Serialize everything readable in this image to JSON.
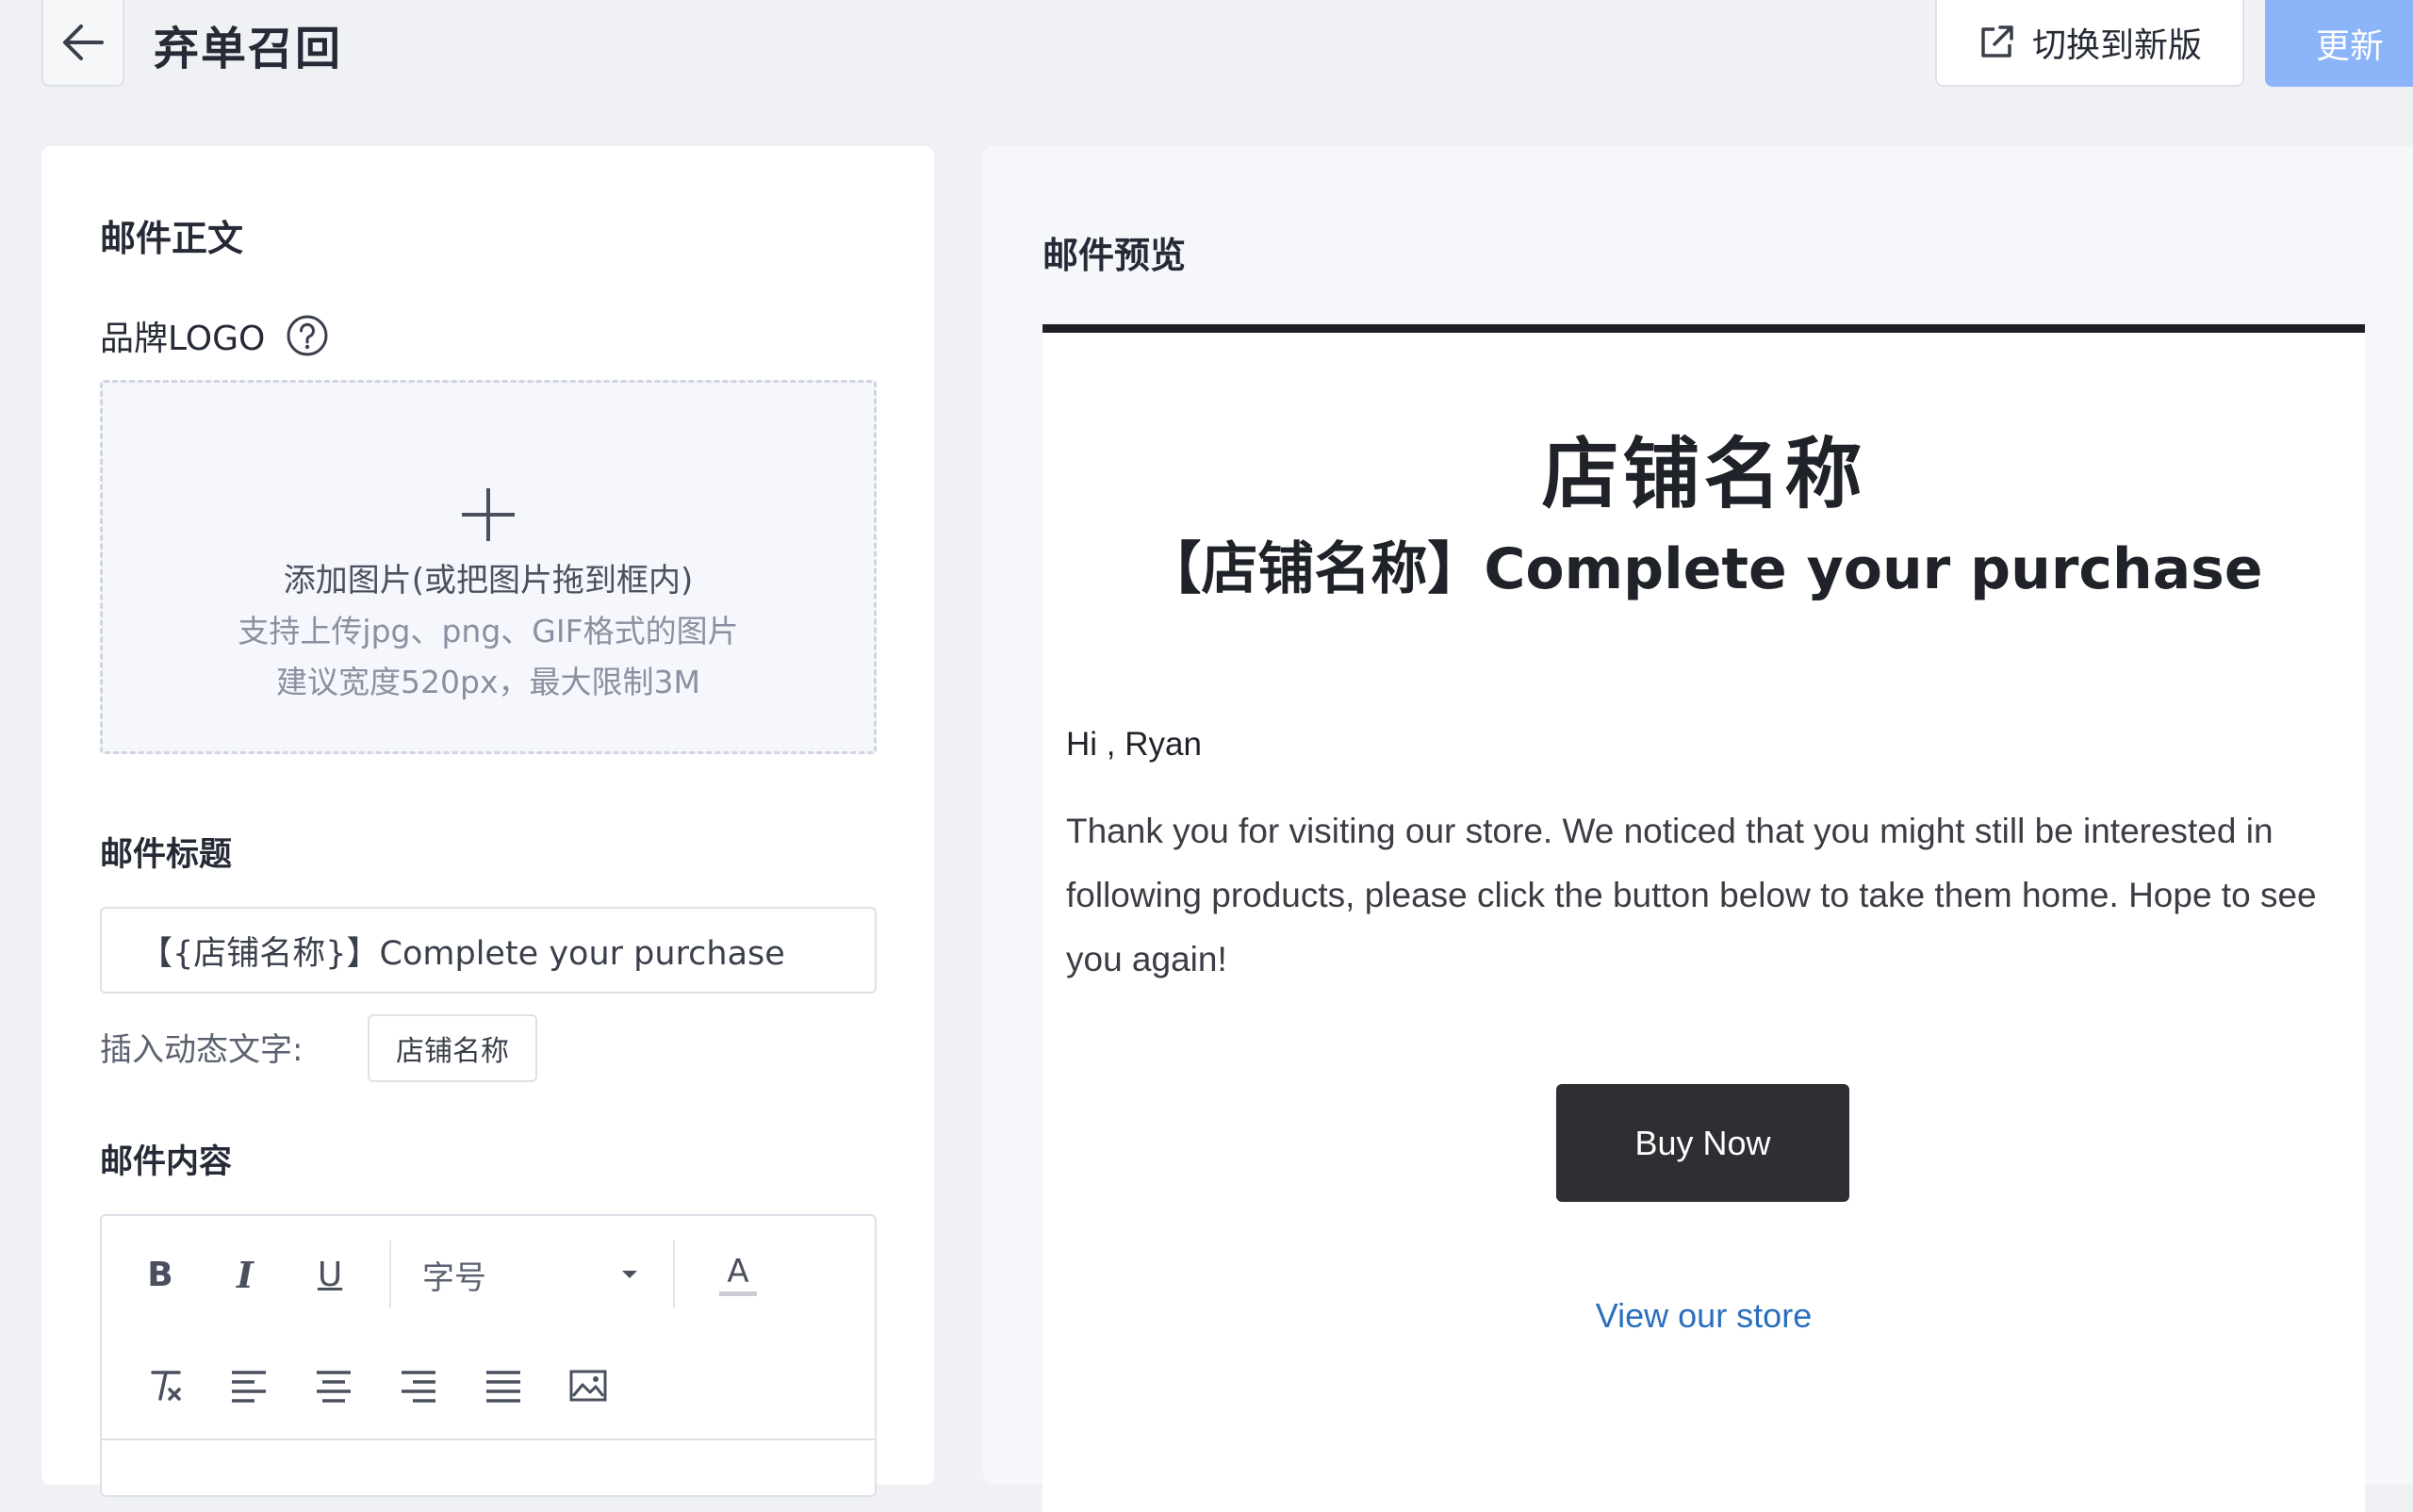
{
  "header": {
    "title": "弃单召回",
    "switch_label": "切换到新版",
    "update_label": "更新"
  },
  "editor_panel": {
    "section_title": "邮件正文",
    "logo_label": "品牌LOGO",
    "upload": {
      "line1": "添加图片(或把图片拖到框内)",
      "line2": "支持上传jpg、png、GIF格式的图片",
      "line3": "建议宽度520px，最大限制3M"
    },
    "subject_title": "邮件标题",
    "subject_value": "【{店铺名称}】Complete your purchase",
    "insert_label": "插入动态文字:",
    "dynamic_tag": "店铺名称",
    "content_title": "邮件内容",
    "toolbar": {
      "bold": "B",
      "italic": "I",
      "underline": "U",
      "font_size": "字号",
      "font_color": "A"
    }
  },
  "preview_panel": {
    "title": "邮件预览",
    "store_name": "店铺名称",
    "subject": "【店铺名称】Complete your purchase",
    "greeting": "Hi , Ryan",
    "body": "Thank you for visiting our store. We noticed that you might still be interested in following products, please click the button below to take them home. Hope to see you again!",
    "button_label": "Buy Now",
    "store_link": "View our store"
  },
  "colors": {
    "primary_disabled": "#8cb4f8",
    "link": "#2a6fbd",
    "button_dark": "#2e2f33"
  }
}
